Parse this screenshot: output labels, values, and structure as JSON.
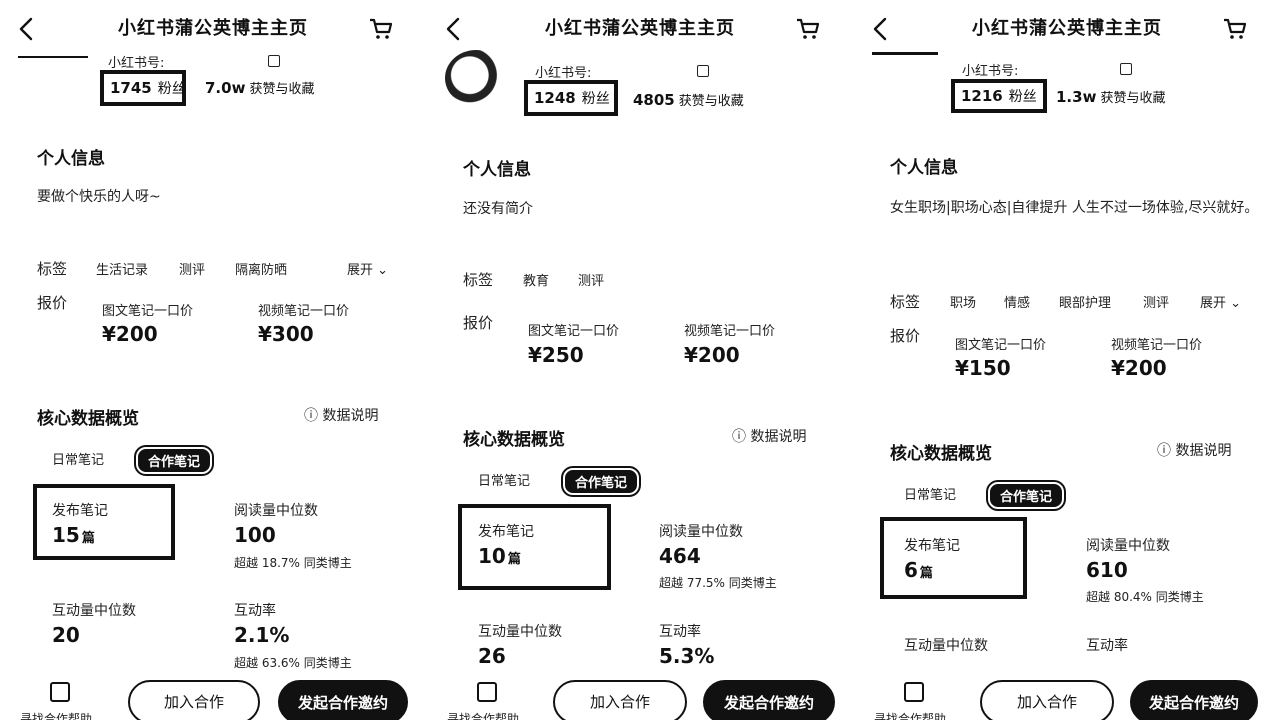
{
  "header": {
    "title": "小红书蒲公英博主主页"
  },
  "common": {
    "id_label": "小红书号:",
    "fans_unit": "粉丝",
    "likes_suffix": "获赞与收藏",
    "section_info": "个人信息",
    "tags_label": "标签",
    "price_label": "报价",
    "image_note_price_label": "图文笔记一口价",
    "video_note_price_label": "视频笔记一口价",
    "core_data_title": "核心数据概览",
    "data_help": "数据说明",
    "tab_daily": "日常笔记",
    "tab_coop": "合作笔记",
    "stat_published": "发布笔记",
    "stat_published_unit": "篇",
    "stat_read_median": "阅读量中位数",
    "stat_interact_median": "互动量中位数",
    "stat_interact_rate": "互动率",
    "bottom_help": "寻找合作帮助",
    "btn_join": "加入合作",
    "btn_invite": "发起合作邀约",
    "expand": "展开"
  },
  "panels": [
    {
      "fans": "1745",
      "likes": "7.0w",
      "bio": "要做个快乐的人呀~",
      "tags": [
        "生活记录",
        "测评",
        "隔离防晒"
      ],
      "image_price": "¥200",
      "video_price": "¥300",
      "published": "15",
      "read_median": "100",
      "read_beat": "超越 18.7% 同类博主",
      "interact_median": "20",
      "interact_rate": "2.1%",
      "interact_beat": "超越 63.6% 同类博主"
    },
    {
      "fans": "1248",
      "likes": "4805",
      "bio": "还没有简介",
      "tags": [
        "教育",
        "测评"
      ],
      "image_price": "¥250",
      "video_price": "¥200",
      "published": "10",
      "read_median": "464",
      "read_beat": "超越 77.5% 同类博主",
      "interact_median": "26",
      "interact_rate": "5.3%"
    },
    {
      "fans": "1216",
      "likes": "1.3w",
      "bio": "女生职场|职场心态|自律提升 人生不过一场体验,尽兴就好。",
      "tags": [
        "职场",
        "情感",
        "眼部护理",
        "测评"
      ],
      "image_price": "¥150",
      "video_price": "¥200",
      "published": "6",
      "read_median": "610",
      "read_beat": "超越 80.4% 同类博主"
    }
  ]
}
